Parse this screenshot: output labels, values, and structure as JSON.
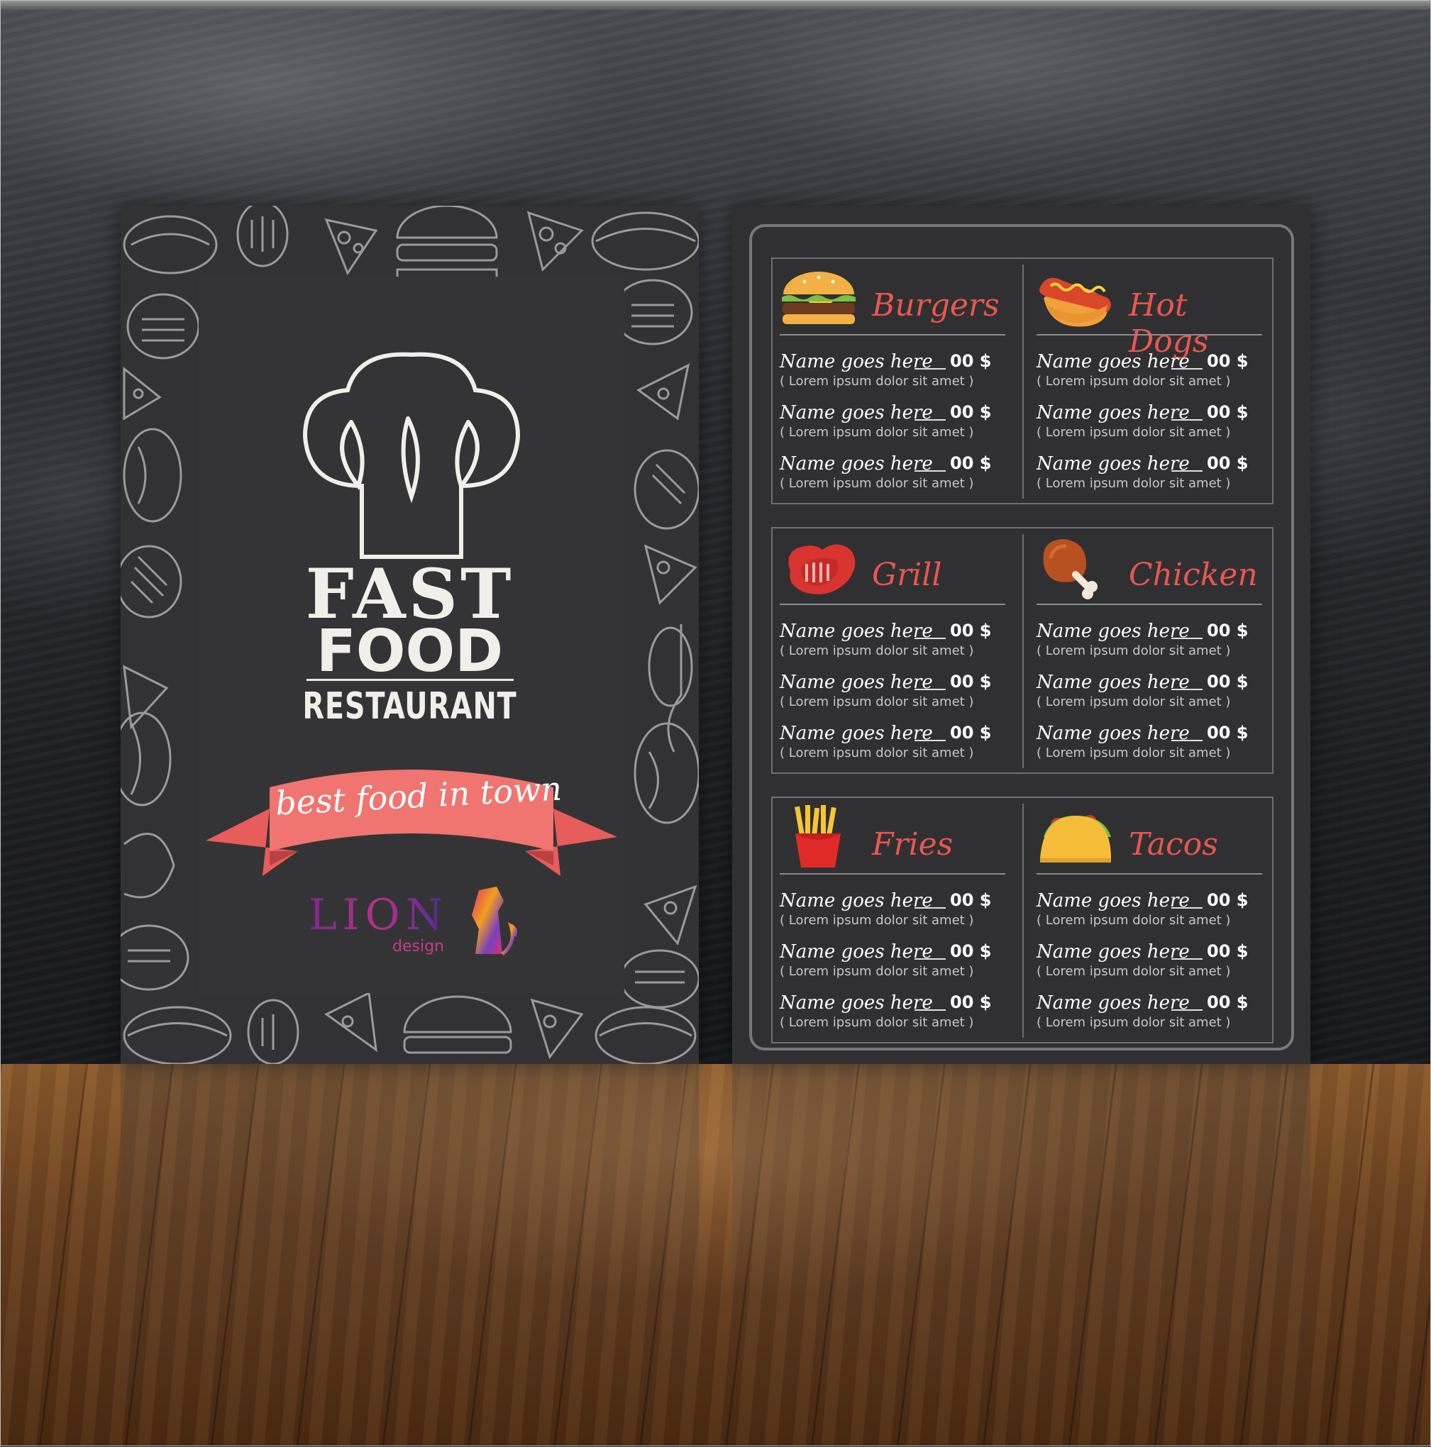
{
  "left_card": {
    "logo": {
      "line1": "FAST",
      "line2": "FOOD",
      "line3": "RESTAURANT"
    },
    "tagline": "best food in town",
    "brand": {
      "name": "LION",
      "sub": "design"
    },
    "colors": {
      "ribbon": "#ef6e6b",
      "background": "#323234"
    }
  },
  "menu": {
    "accent_color": "#e8574f",
    "sections": [
      {
        "categories": [
          {
            "title": "Burgers",
            "icon": "burger-icon",
            "items": [
              {
                "name": "Name goes here",
                "price": "00 $",
                "desc": "( Lorem ipsum dolor sit amet )"
              },
              {
                "name": "Name goes here",
                "price": "00 $",
                "desc": "( Lorem ipsum dolor sit amet )"
              },
              {
                "name": "Name goes here",
                "price": "00 $",
                "desc": "( Lorem ipsum dolor sit amet )"
              }
            ]
          },
          {
            "title": "Hot Dogs",
            "icon": "hotdog-icon",
            "items": [
              {
                "name": "Name goes here",
                "price": "00 $",
                "desc": "( Lorem ipsum dolor sit amet )"
              },
              {
                "name": "Name goes here",
                "price": "00 $",
                "desc": "( Lorem ipsum dolor sit amet )"
              },
              {
                "name": "Name goes here",
                "price": "00 $",
                "desc": "( Lorem ipsum dolor sit amet )"
              }
            ]
          }
        ]
      },
      {
        "categories": [
          {
            "title": "Grill",
            "icon": "steak-icon",
            "items": [
              {
                "name": "Name goes here",
                "price": "00 $",
                "desc": "( Lorem ipsum dolor sit amet )"
              },
              {
                "name": "Name goes here",
                "price": "00 $",
                "desc": "( Lorem ipsum dolor sit amet )"
              },
              {
                "name": "Name goes here",
                "price": "00 $",
                "desc": "( Lorem ipsum dolor sit amet )"
              }
            ]
          },
          {
            "title": "Chicken",
            "icon": "chicken-leg-icon",
            "items": [
              {
                "name": "Name goes here",
                "price": "00 $",
                "desc": "( Lorem ipsum dolor sit amet )"
              },
              {
                "name": "Name goes here",
                "price": "00 $",
                "desc": "( Lorem ipsum dolor sit amet )"
              },
              {
                "name": "Name goes here",
                "price": "00 $",
                "desc": "( Lorem ipsum dolor sit amet )"
              }
            ]
          }
        ]
      },
      {
        "categories": [
          {
            "title": "Fries",
            "icon": "fries-icon",
            "items": [
              {
                "name": "Name goes here",
                "price": "00 $",
                "desc": "( Lorem ipsum dolor sit amet )"
              },
              {
                "name": "Name goes here",
                "price": "00 $",
                "desc": "( Lorem ipsum dolor sit amet )"
              },
              {
                "name": "Name goes here",
                "price": "00 $",
                "desc": "( Lorem ipsum dolor sit amet )"
              }
            ]
          },
          {
            "title": "Tacos",
            "icon": "taco-icon",
            "items": [
              {
                "name": "Name goes here",
                "price": "00 $",
                "desc": "( Lorem ipsum dolor sit amet )"
              },
              {
                "name": "Name goes here",
                "price": "00 $",
                "desc": "( Lorem ipsum dolor sit amet )"
              },
              {
                "name": "Name goes here",
                "price": "00 $",
                "desc": "( Lorem ipsum dolor sit amet )"
              }
            ]
          }
        ]
      }
    ]
  }
}
